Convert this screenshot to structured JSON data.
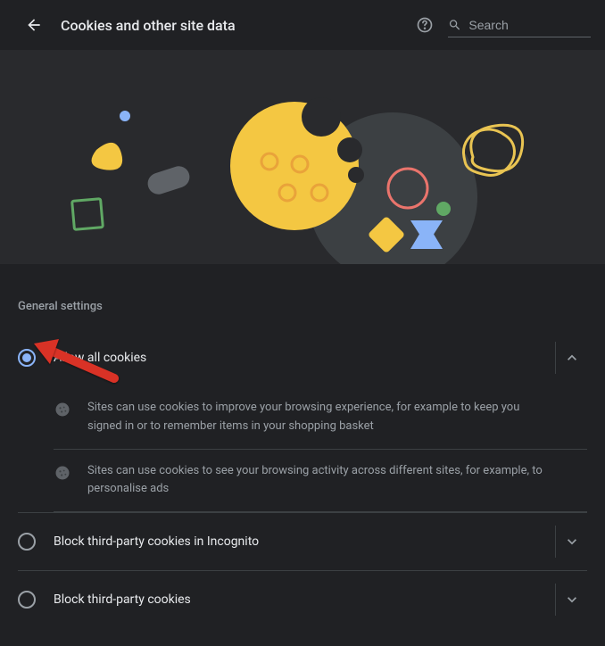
{
  "header": {
    "title": "Cookies and other site data",
    "search_placeholder": "Search"
  },
  "section_heading": "General settings",
  "options": [
    {
      "label": "Allow all cookies",
      "selected": true,
      "expanded": true,
      "details": [
        "Sites can use cookies to improve your browsing experience, for example to keep you signed in or to remember items in your shopping basket",
        "Sites can use cookies to see your browsing activity across different sites, for example, to personalise ads"
      ]
    },
    {
      "label": "Block third-party cookies in Incognito",
      "selected": false,
      "expanded": false
    },
    {
      "label": "Block third-party cookies",
      "selected": false,
      "expanded": false
    }
  ]
}
